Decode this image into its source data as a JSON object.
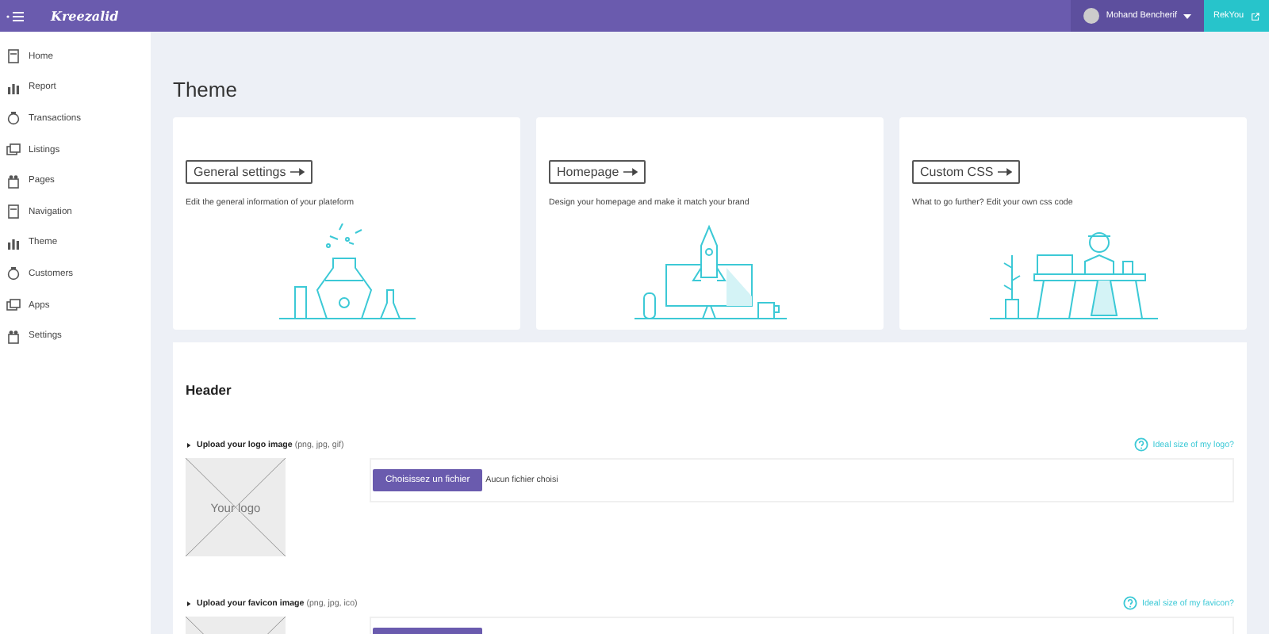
{
  "topbar": {
    "brand": "Kreezalid",
    "user_name": "Mohand Bencherif",
    "site_link": "RekYou"
  },
  "sidebar": {
    "items": [
      {
        "label": "Home",
        "selected": false
      },
      {
        "label": "Report",
        "selected": false
      },
      {
        "label": "Transactions",
        "selected": false
      },
      {
        "label": "Listings",
        "selected": false
      },
      {
        "label": "Pages",
        "selected": false
      },
      {
        "label": "Navigation",
        "selected": false
      },
      {
        "label": "Theme",
        "selected": false
      },
      {
        "label": "Customers",
        "selected": false
      },
      {
        "label": "Apps",
        "selected": false
      },
      {
        "label": "Settings",
        "selected": false
      }
    ]
  },
  "page_title": "Theme",
  "cards": [
    {
      "button": "General settings",
      "description": "Edit the general information of your plateform"
    },
    {
      "button": "Homepage",
      "description": "Design your homepage and make it match your brand"
    },
    {
      "button": "Custom CSS",
      "description": "What to go further? Edit your own css code"
    }
  ],
  "header_section": {
    "title": "Header",
    "uploads": [
      {
        "label": "Upload your logo image",
        "formats": "(png, jpg, gif)",
        "help_link": "Ideal size of my logo?",
        "preview_text": "Your logo",
        "button": "Choisissez un fichier",
        "file_status": "Aucun fichier choisi"
      },
      {
        "label": "Upload your favicon image",
        "formats": "(png, jpg, ico)",
        "help_link": "Ideal size of my favicon?"
      }
    ]
  }
}
